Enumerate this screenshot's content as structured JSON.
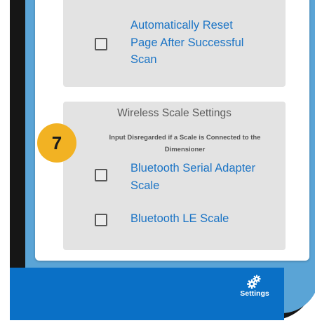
{
  "settings": {
    "reset_option": {
      "label_lines": [
        "Automatically Reset",
        "Page After Successful",
        "Scan"
      ],
      "checked": false
    },
    "scale_section": {
      "title": "Wireless Scale Settings",
      "note_lines": [
        "Input Disregarded if a Scale is Connected to the",
        "Dimensioner"
      ],
      "options": [
        {
          "label_lines": [
            "Bluetooth Serial Adapter",
            "Scale"
          ],
          "checked": false
        },
        {
          "label_lines": [
            "Bluetooth LE Scale"
          ],
          "checked": false
        }
      ]
    }
  },
  "annotation": {
    "step": "7",
    "color": "#f2b223"
  },
  "bottom_nav": {
    "settings_label": "Settings",
    "settings_icon": "gears-icon",
    "bar_color": "#0a70c6"
  },
  "theme": {
    "accent": "#1b74c5",
    "screen_border": "#5aa4d6"
  }
}
